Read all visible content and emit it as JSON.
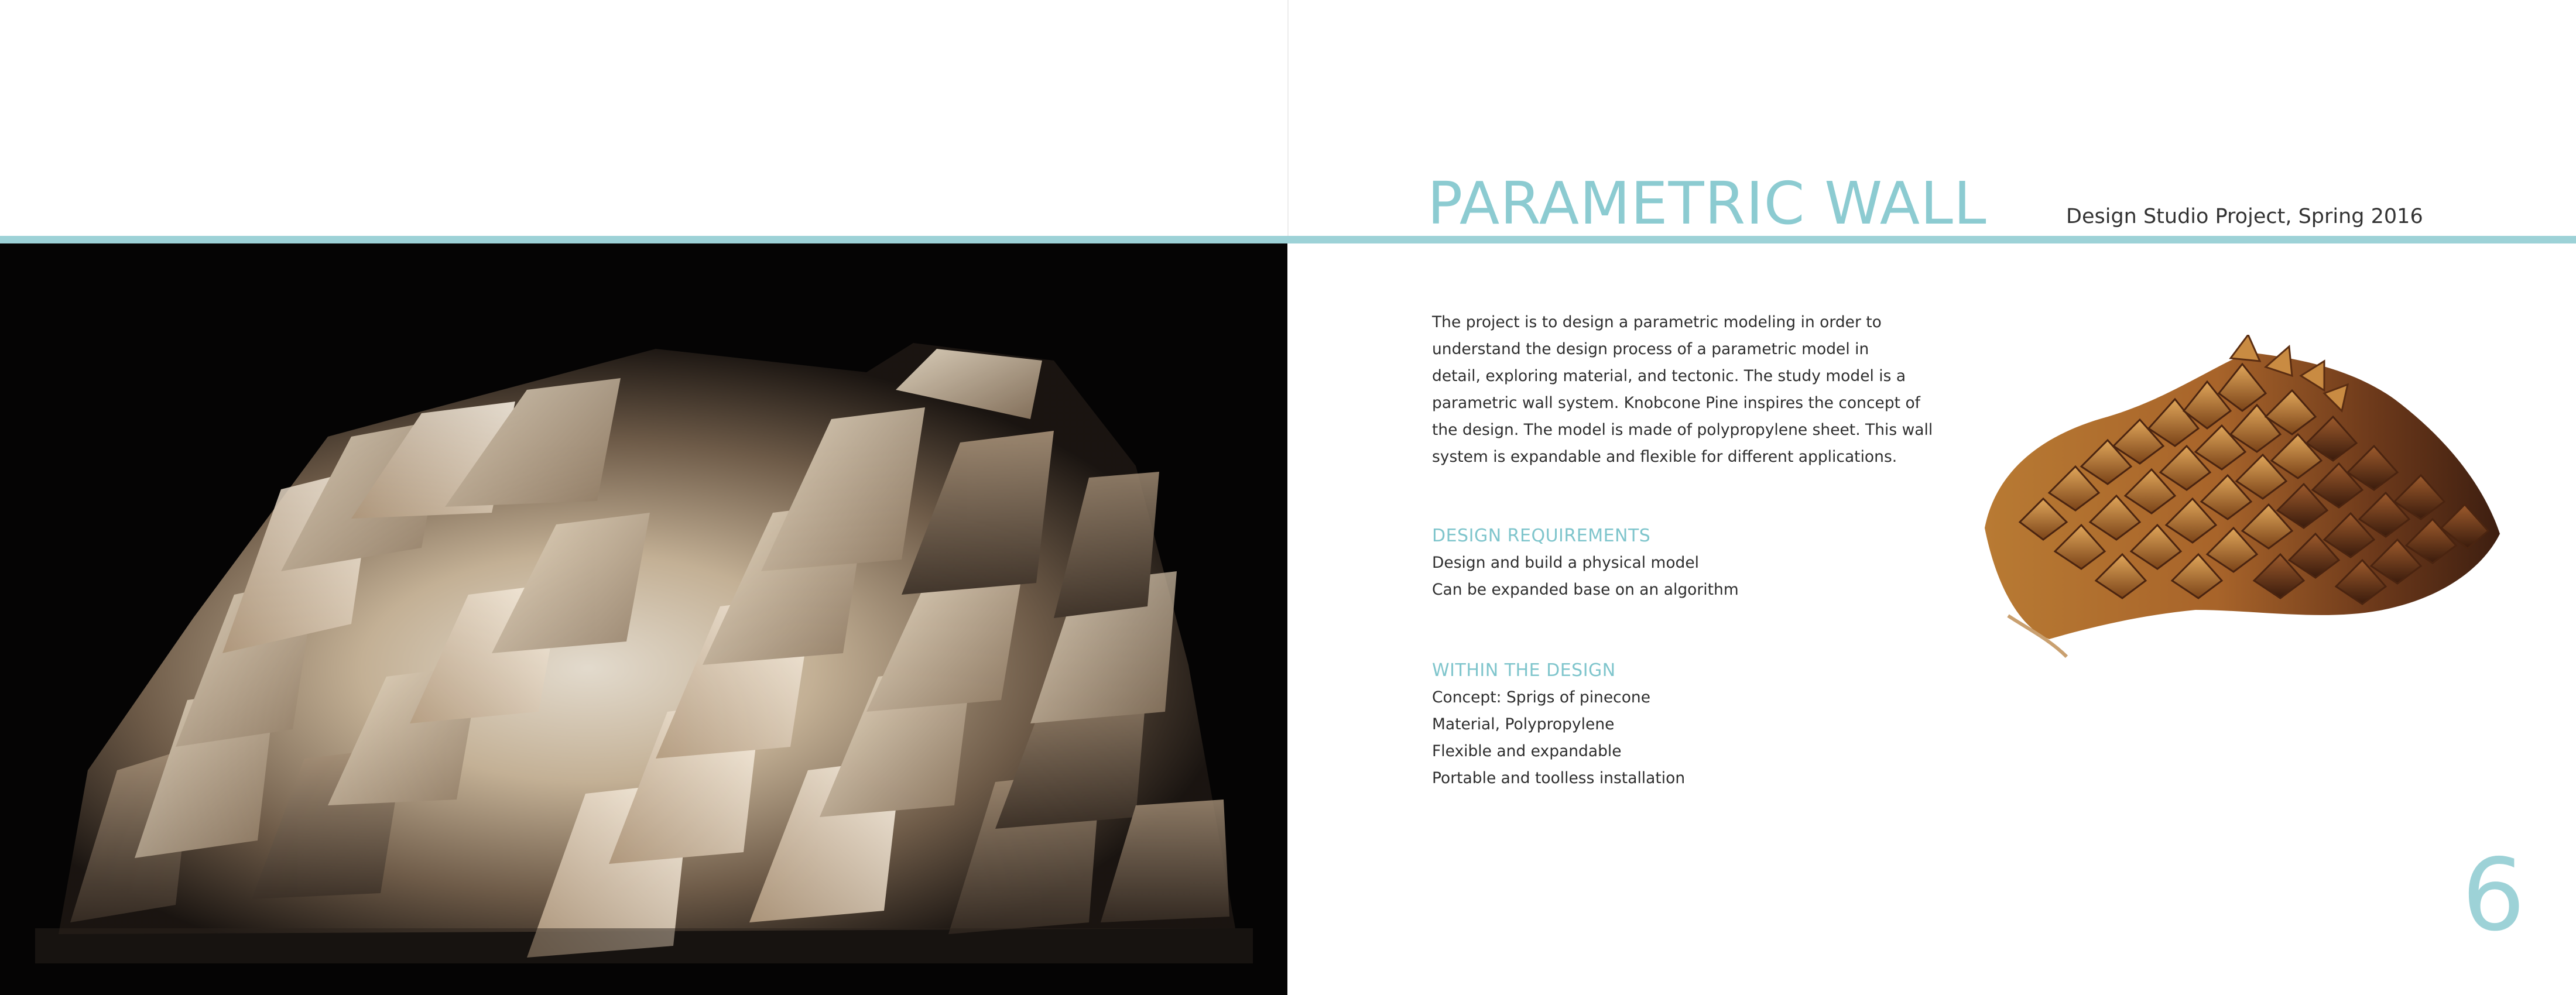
{
  "header": {
    "title": "PARAMETRIC WALL",
    "subtitle": "Design Studio Project, Spring 2016"
  },
  "description": {
    "lines": [
      "The project is to design a parametric modeling in order to",
      "understand the design process of a parametric model in",
      "detail, exploring material, and tectonic. The study model is a",
      "parametric wall system. Knobcone Pine inspires the concept of",
      "the design. The model is made of polypropylene sheet. This wall",
      "system is expandable and flexible for different applications."
    ]
  },
  "design_requirements": {
    "heading": "DESIGN REQUIREMENTS",
    "items": [
      "Design and build a physical model",
      "Can be expanded base on an algorithm"
    ]
  },
  "within_the_design": {
    "heading": "WITHIN THE DESIGN",
    "items": [
      "Concept: Sprigs of pinecone",
      "Material, Polypropylene",
      "Flexible and expandable",
      "Portable and toolless installation"
    ]
  },
  "page_number": "6",
  "colors": {
    "accent": "#9dd2d7",
    "title": "#8ccbd1",
    "text": "#2e2e2e",
    "photo_background": "#050404"
  }
}
